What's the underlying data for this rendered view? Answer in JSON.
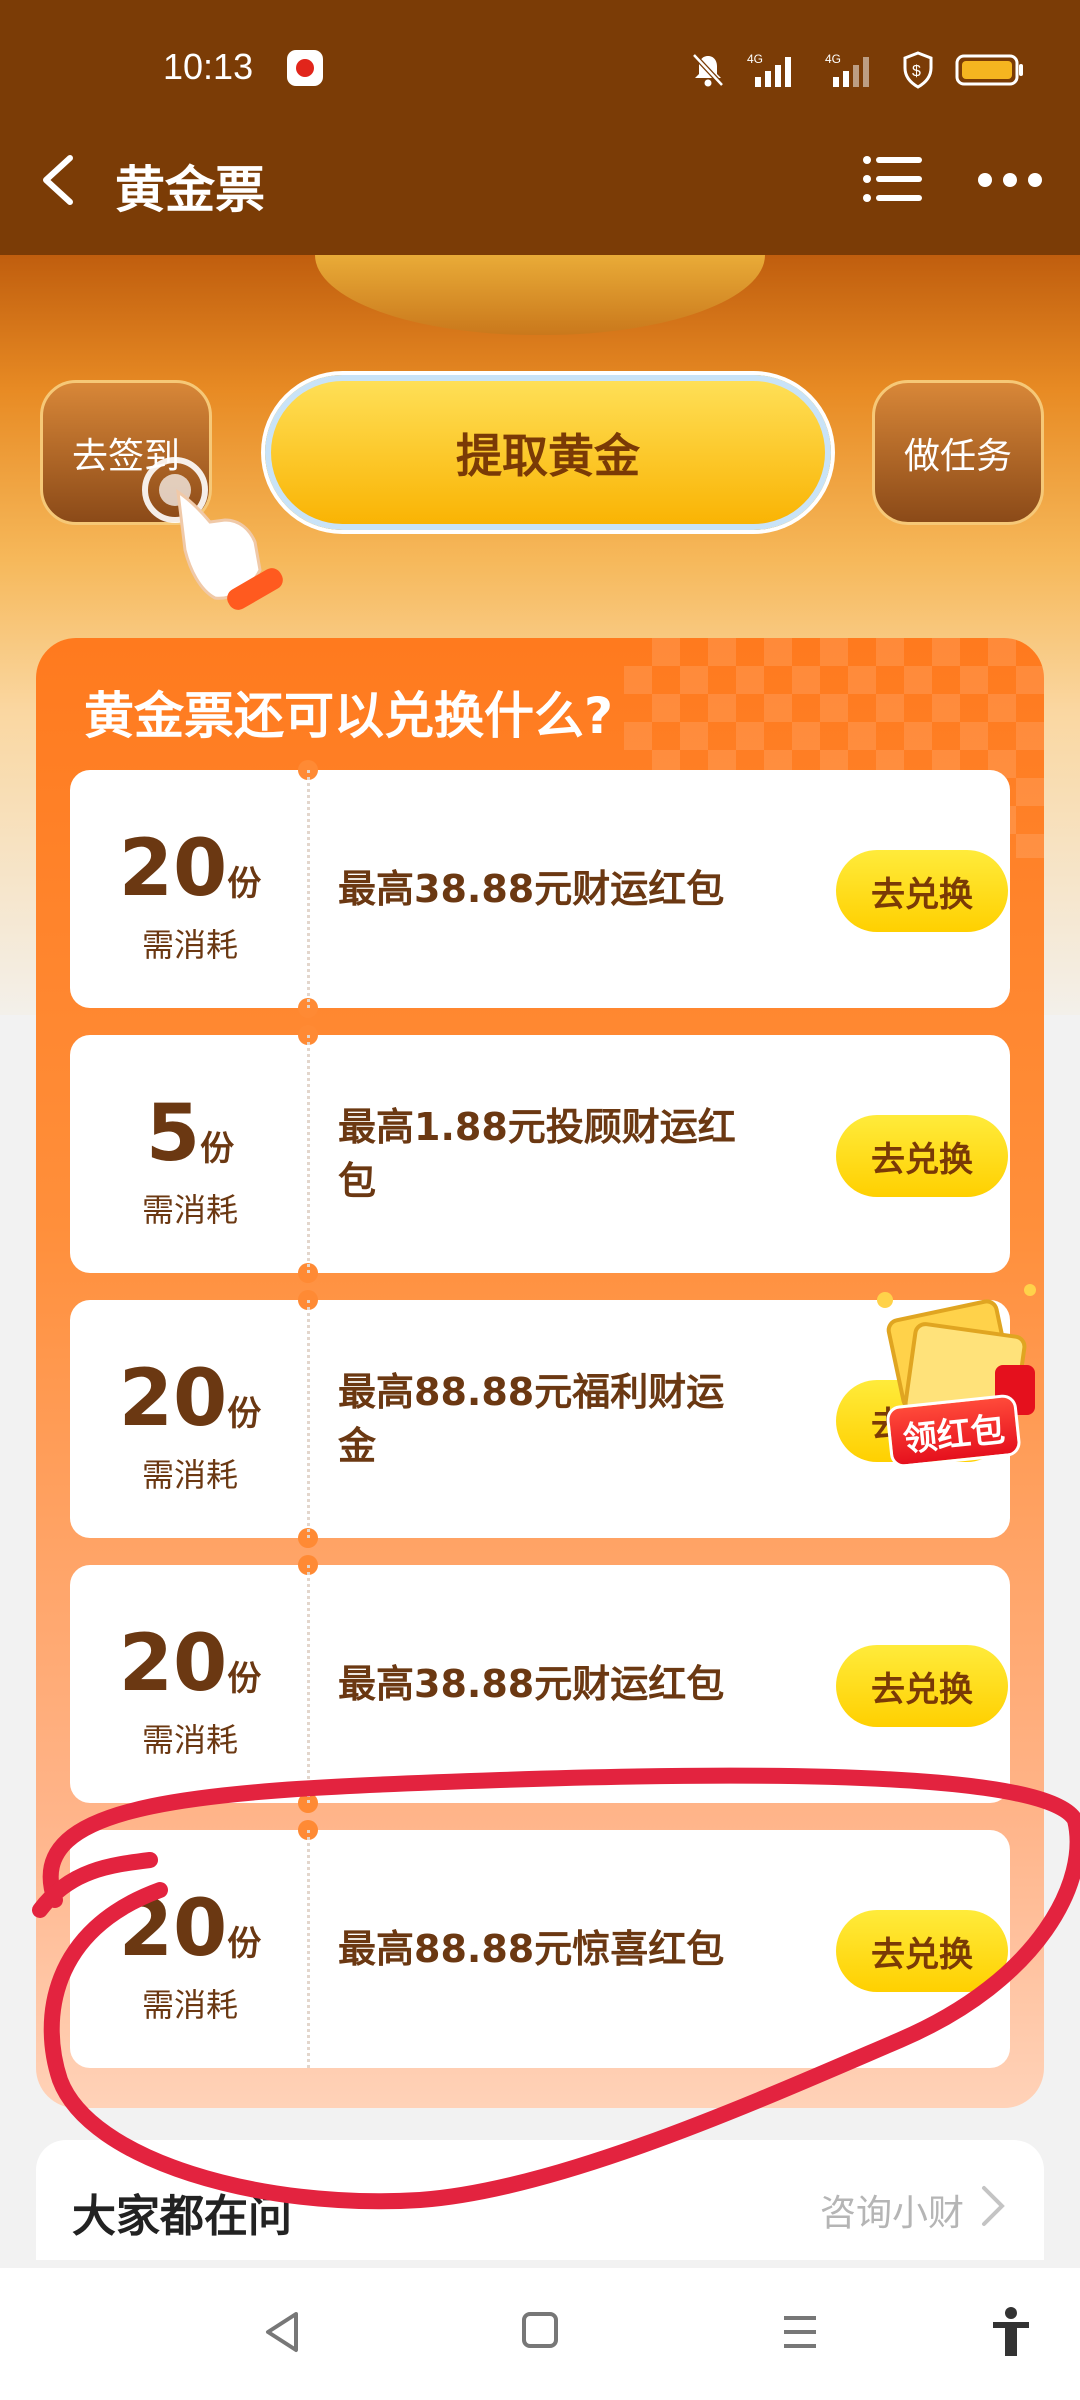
{
  "status_bar": {
    "time": "10:13",
    "network_1": "4G",
    "network_2": "4G"
  },
  "title_bar": {
    "title": "黄金票"
  },
  "hero": {
    "signin_label": "去签到",
    "extract_label": "提取黄金",
    "task_label": "做任务"
  },
  "exchange_panel": {
    "title": "黄金票还可以兑换什么?",
    "items": [
      {
        "qty": "20",
        "unit": "份",
        "label": "需消耗",
        "title": "最高38.88元财运红包",
        "button": "去兑换"
      },
      {
        "qty": "5",
        "unit": "份",
        "label": "需消耗",
        "title": "最高1.88元投顾财运红包",
        "button": "去兑换"
      },
      {
        "qty": "20",
        "unit": "份",
        "label": "需消耗",
        "title": "最高88.88元福利财运金",
        "button": "去兑换"
      },
      {
        "qty": "20",
        "unit": "份",
        "label": "需消耗",
        "title": "最高38.88元财运红包",
        "button": "去兑换"
      },
      {
        "qty": "20",
        "unit": "份",
        "label": "需消耗",
        "title": "最高88.88元惊喜红包",
        "button": "去兑换"
      }
    ],
    "redpacket_badge": "领红包"
  },
  "ask_section": {
    "title": "大家都在问",
    "link": "咨询小财"
  },
  "colors": {
    "title_bar_bg": "#7b3c06",
    "accent_orange": "#ff7a1e",
    "button_yellow": "#ffd000",
    "annotation_red": "#e3233f"
  }
}
